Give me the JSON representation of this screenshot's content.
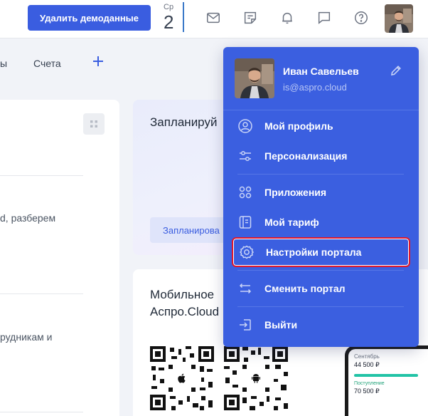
{
  "topbar": {
    "demo_button_label": "Удалить демоданные",
    "date": {
      "weekday": "Ср",
      "day": "2"
    }
  },
  "tabs": {
    "partial_label": "ы",
    "accounts_label": "Счета"
  },
  "left_card": {
    "texts": [
      "d, разберем",
      "рудникам и"
    ]
  },
  "plan_card": {
    "title": "Запланируй",
    "button_label": "Запланирова"
  },
  "mobile_card": {
    "title_line1": "Мобильное",
    "title_line2": "Аспро.Cloud"
  },
  "phone_preview": {
    "month": "Сентябрь",
    "amount1": "44 500 ₽",
    "income_label": "Поступление",
    "amount2": "70 500 ₽"
  },
  "user": {
    "name": "Иван Савельев",
    "email": "is@aspro.cloud"
  },
  "menu": {
    "items": [
      {
        "label": "Мой профиль",
        "icon": "user-circle-icon"
      },
      {
        "label": "Персонализация",
        "icon": "sliders-icon"
      },
      {
        "label": "Приложения",
        "icon": "apps-grid-icon"
      },
      {
        "label": "Мой тариф",
        "icon": "tariff-icon"
      },
      {
        "label": "Настройки портала",
        "icon": "gear-icon"
      },
      {
        "label": "Сменить портал",
        "icon": "swap-arrows-icon"
      },
      {
        "label": "Выйти",
        "icon": "logout-icon"
      }
    ]
  },
  "colors": {
    "accent": "#3a5de0",
    "menu_bg": "#3b5fe0",
    "highlight_border": "#e0182d",
    "phone_bar": "#22c3a6"
  }
}
